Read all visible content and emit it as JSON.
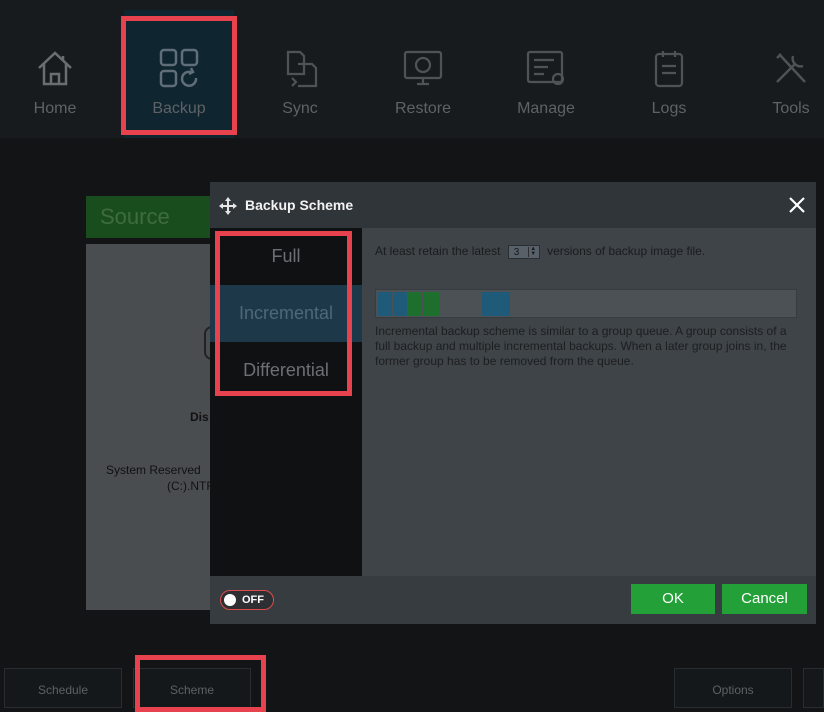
{
  "nav": {
    "items": [
      {
        "label": "Home",
        "icon": "home-icon"
      },
      {
        "label": "Backup",
        "icon": "backup-icon"
      },
      {
        "label": "Sync",
        "icon": "sync-icon"
      },
      {
        "label": "Restore",
        "icon": "restore-icon"
      },
      {
        "label": "Manage",
        "icon": "manage-icon"
      },
      {
        "label": "Logs",
        "icon": "logs-icon"
      },
      {
        "label": "Tools",
        "icon": "tools-icon"
      }
    ],
    "active": "Backup"
  },
  "background": {
    "source_tab": "Source",
    "disk_label": "Dis",
    "partition_line1": "System Reserved",
    "partition_line2": "(C:).NTF"
  },
  "dialog": {
    "title": "Backup Scheme",
    "schemes": [
      "Full",
      "Incremental",
      "Differential"
    ],
    "selected_scheme": "Incremental",
    "retain_prefix": "At least retain the latest",
    "retain_count": "3",
    "retain_suffix": "versions of backup image file.",
    "description": "Incremental backup scheme is similar to a group queue. A group consists of a full backup and multiple incremental backups. When a later group joins in, the former group has to be removed from the queue.",
    "toggle_label": "OFF",
    "toggle_state": "off",
    "ok_label": "OK",
    "cancel_label": "Cancel"
  },
  "bottom": {
    "schedule_label": "Schedule",
    "scheme_label": "Scheme",
    "options_label": "Options"
  },
  "colors": {
    "highlight": "#e8424f",
    "accent_green": "#23a037",
    "selected_bg": "#1d3848"
  }
}
